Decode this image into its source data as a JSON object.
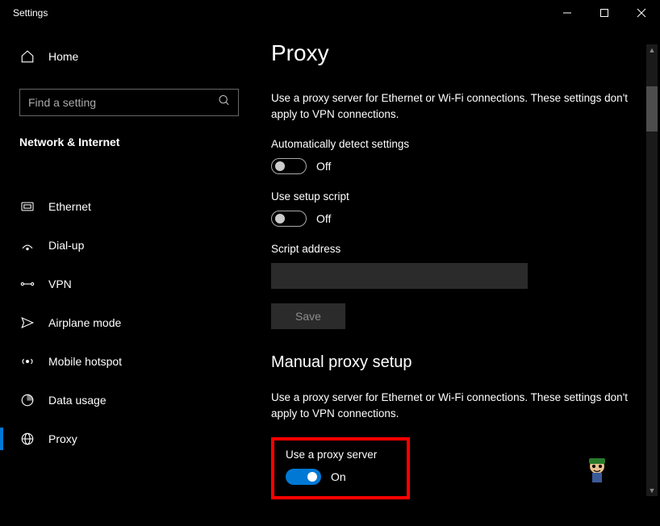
{
  "window": {
    "title": "Settings"
  },
  "sidebar": {
    "home": "Home",
    "search_placeholder": "Find a setting",
    "section": "Network & Internet",
    "items": [
      {
        "label": "Ethernet"
      },
      {
        "label": "Dial-up"
      },
      {
        "label": "VPN"
      },
      {
        "label": "Airplane mode"
      },
      {
        "label": "Mobile hotspot"
      },
      {
        "label": "Data usage"
      },
      {
        "label": "Proxy"
      }
    ]
  },
  "page": {
    "title": "Proxy",
    "desc1": "Use a proxy server for Ethernet or Wi-Fi connections. These settings don't apply to VPN connections.",
    "auto_detect_label": "Automatically detect settings",
    "auto_detect_state": "Off",
    "setup_script_label": "Use setup script",
    "setup_script_state": "Off",
    "script_address_label": "Script address",
    "script_address_value": "",
    "save_label": "Save",
    "manual_heading": "Manual proxy setup",
    "desc2": "Use a proxy server for Ethernet or Wi-Fi connections. These settings don't apply to VPN connections.",
    "use_proxy_label": "Use a proxy server",
    "use_proxy_state": "On"
  }
}
